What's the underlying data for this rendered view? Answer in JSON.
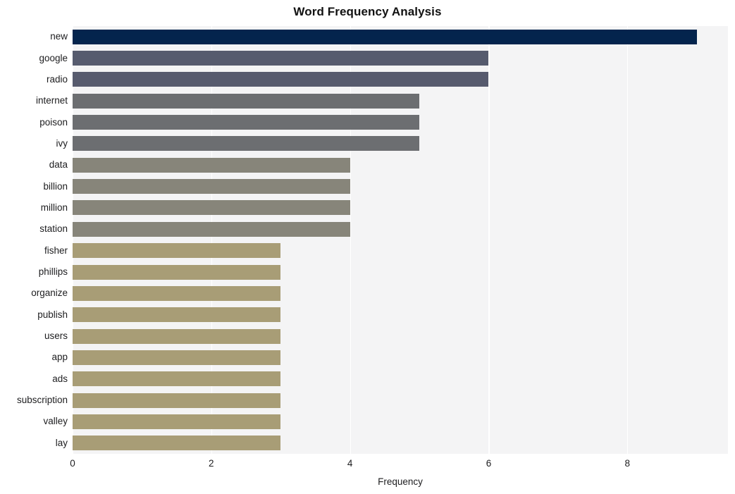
{
  "chart_data": {
    "type": "bar",
    "orientation": "horizontal",
    "title": "Word Frequency Analysis",
    "xlabel": "Frequency",
    "ylabel": "",
    "categories": [
      "new",
      "google",
      "radio",
      "internet",
      "poison",
      "ivy",
      "data",
      "billion",
      "million",
      "station",
      "fisher",
      "phillips",
      "organize",
      "publish",
      "users",
      "app",
      "ads",
      "subscription",
      "valley",
      "lay"
    ],
    "values": [
      9,
      6,
      6,
      5,
      5,
      5,
      4,
      4,
      4,
      4,
      3,
      3,
      3,
      3,
      3,
      3,
      3,
      3,
      3,
      3
    ],
    "bar_colors": [
      "#04244d",
      "#565b6e",
      "#575b6e",
      "#6c6e71",
      "#6c6e71",
      "#6c6e71",
      "#87857a",
      "#87857a",
      "#87857a",
      "#87857a",
      "#a89d76",
      "#a89d76",
      "#a89d76",
      "#a89d76",
      "#a89d76",
      "#a89d76",
      "#a89d76",
      "#a89d76",
      "#a89d76",
      "#a89d76"
    ],
    "xlim": [
      0,
      9.45
    ],
    "ylim_count": 20,
    "x_ticks": [
      0,
      2,
      4,
      6,
      8
    ],
    "x_tick_labels": [
      "0",
      "2",
      "4",
      "6",
      "8"
    ],
    "grid": {
      "vertical": true,
      "horizontal": false,
      "color": "#ffffff"
    },
    "legend": {
      "visible": false,
      "position": "none"
    },
    "style": {
      "plot_background": "#f4f4f5",
      "figure_background": "#ffffff",
      "text_color": "#1d1d1f",
      "title_color": "#111111"
    }
  }
}
